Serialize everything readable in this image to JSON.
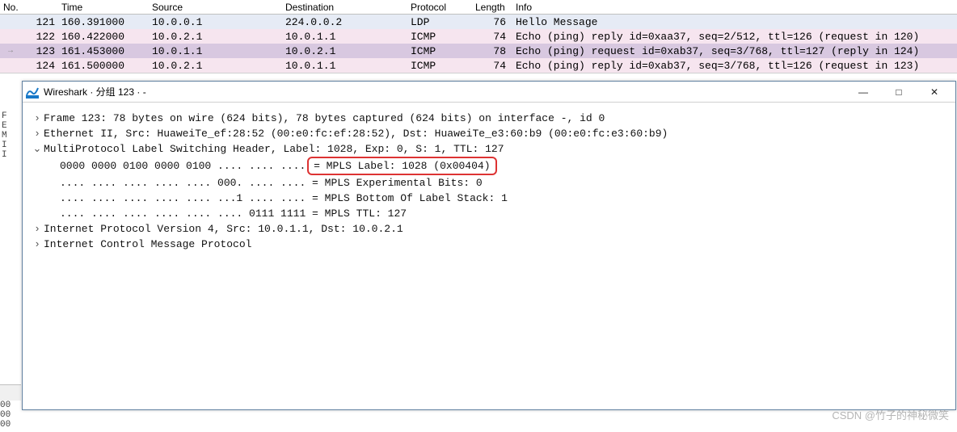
{
  "columns": {
    "no": "No.",
    "time": "Time",
    "src": "Source",
    "dst": "Destination",
    "proto": "Protocol",
    "len": "Length",
    "info": "Info"
  },
  "packets": [
    {
      "no": "121",
      "time": "160.391000",
      "src": "10.0.0.1",
      "dst": "224.0.0.2",
      "proto": "LDP",
      "len": "76",
      "info": "Hello Message",
      "bg": "bg-blue",
      "edge": ""
    },
    {
      "no": "122",
      "time": "160.422000",
      "src": "10.0.2.1",
      "dst": "10.0.1.1",
      "proto": "ICMP",
      "len": "74",
      "info": "Echo (ping) reply    id=0xaa37, seq=2/512, ttl=126 (request in 120)",
      "bg": "bg-pink",
      "edge": ""
    },
    {
      "no": "123",
      "time": "161.453000",
      "src": "10.0.1.1",
      "dst": "10.0.2.1",
      "proto": "ICMP",
      "len": "78",
      "info": "Echo (ping) request  id=0xab37, seq=3/768, ttl=127 (reply in 124)",
      "bg": "bg-purple",
      "edge": "→"
    },
    {
      "no": "124",
      "time": "161.500000",
      "src": "10.0.2.1",
      "dst": "10.0.1.1",
      "proto": "ICMP",
      "len": "74",
      "info": "Echo (ping) reply    id=0xab37, seq=3/768, ttl=126 (request in 123)",
      "bg": "bg-pink",
      "edge": ""
    }
  ],
  "window": {
    "title": "Wireshark · 分组 123 · -",
    "btn_min": "—",
    "btn_max": "□",
    "btn_close": "✕"
  },
  "tree": {
    "frame": "Frame 123: 78 bytes on wire (624 bits), 78 bytes captured (624 bits) on interface -, id 0",
    "eth": "Ethernet II, Src: HuaweiTe_ef:28:52 (00:e0:fc:ef:28:52), Dst: HuaweiTe_e3:60:b9 (00:e0:fc:e3:60:b9)",
    "mpls": "MultiProtocol Label Switching Header, Label: 1028, Exp: 0, S: 1, TTL: 127",
    "mpls_label_bits": "0000 0000 0100 0000 0100 .... .... .... ",
    "mpls_label_val": "= MPLS Label: 1028 (0x00404)",
    "mpls_exp": ".... .... .... .... .... 000. .... .... = MPLS Experimental Bits: 0",
    "mpls_bos": ".... .... .... .... .... ...1 .... .... = MPLS Bottom Of Label Stack: 1",
    "mpls_ttl": ".... .... .... .... .... .... 0111 1111 = MPLS TTL: 127",
    "ip": "Internet Protocol Version 4, Src: 10.0.1.1, Dst: 10.0.2.1",
    "icmp": "Internet Control Message Protocol"
  },
  "carets": {
    "closed": "›",
    "open": "⌄"
  },
  "leftletters": [
    "F",
    "E",
    "M",
    "I",
    "I"
  ],
  "hexlines": [
    "00",
    "00",
    "00"
  ],
  "watermark": "CSDN @竹子的神秘微笑"
}
